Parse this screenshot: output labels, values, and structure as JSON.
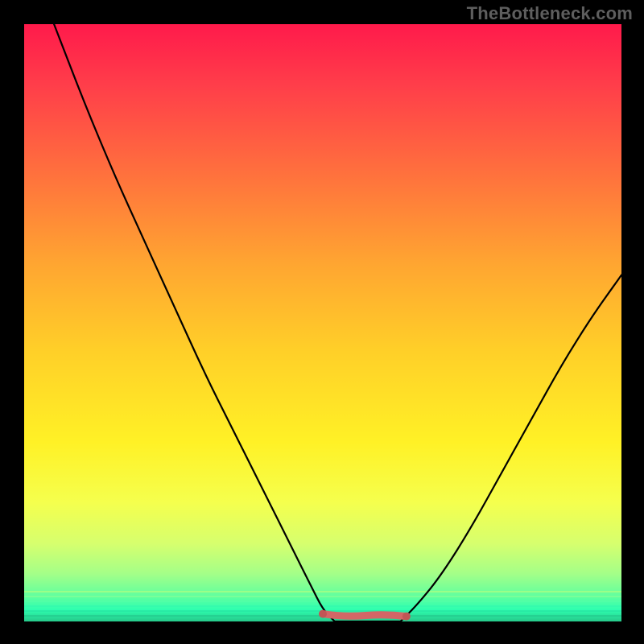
{
  "watermark": "TheBottleneck.com",
  "colors": {
    "curve": "#000000",
    "highlight": "#d36666",
    "frame": "#000000"
  },
  "chart_data": {
    "type": "line",
    "title": "",
    "xlabel": "",
    "ylabel": "",
    "xlim": [
      0,
      100
    ],
    "ylim": [
      0,
      100
    ],
    "note": "y represents bottleneck percentage (0 = optimal, 100 = worst). Values estimated from pixel positions.",
    "series": [
      {
        "name": "left-branch",
        "x": [
          5,
          10,
          15,
          20,
          25,
          30,
          35,
          40,
          45,
          48,
          50,
          52
        ],
        "y": [
          100,
          87,
          75,
          64,
          53,
          42,
          32,
          22,
          12,
          6,
          2,
          0
        ]
      },
      {
        "name": "flat-bottom",
        "x": [
          52,
          55,
          58,
          61,
          63
        ],
        "y": [
          0,
          0,
          0,
          0,
          0
        ]
      },
      {
        "name": "right-branch",
        "x": [
          63,
          66,
          70,
          75,
          80,
          85,
          90,
          95,
          100
        ],
        "y": [
          0,
          3,
          8,
          16,
          25,
          34,
          43,
          51,
          58
        ]
      }
    ],
    "optimal_range": {
      "x_start": 50,
      "x_end": 64,
      "y": 1
    }
  }
}
